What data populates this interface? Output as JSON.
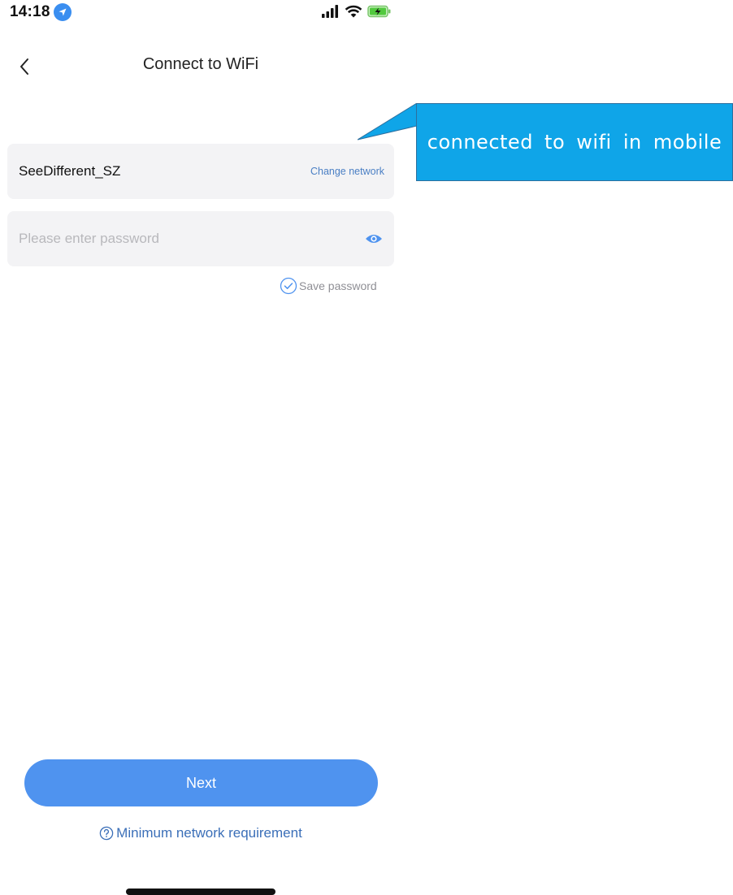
{
  "status_bar": {
    "time": "14:18",
    "icons": [
      "location-icon",
      "signal-icon",
      "wifi-icon",
      "battery-charging-icon"
    ]
  },
  "nav": {
    "back_icon": "chevron-left-icon",
    "title": "Connect to WiFi"
  },
  "network": {
    "name": "SeeDifferent_SZ",
    "change_label": "Change network"
  },
  "password": {
    "value": "",
    "placeholder": "Please enter password",
    "visibility_icon": "eye-icon",
    "save_label": "Save password",
    "save_checked": true
  },
  "callout": {
    "text": "connected to wifi in mobile"
  },
  "footer": {
    "next_label": "Next",
    "requirement_label": "Minimum network requirement",
    "requirement_icon": "question-circle-icon"
  },
  "colors": {
    "accent": "#4f93ef",
    "link": "#3b6fb8",
    "callout_bg": "#0fa5e8",
    "card_bg": "#f3f3f5"
  }
}
